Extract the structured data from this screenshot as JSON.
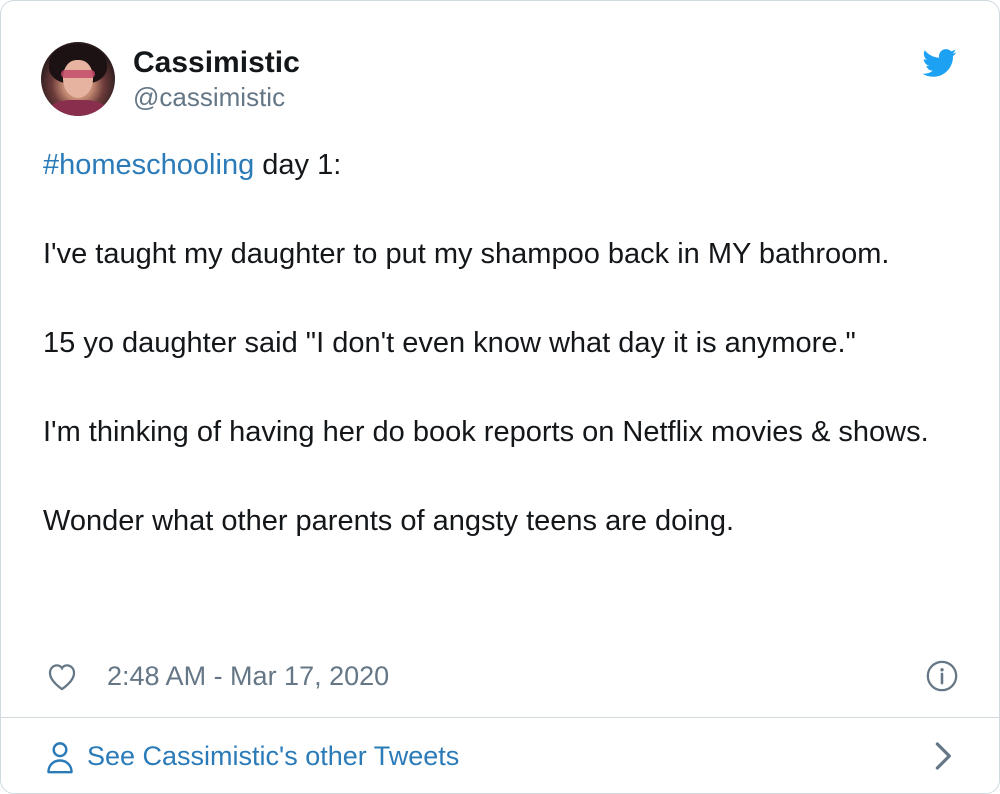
{
  "user": {
    "display_name": "Cassimistic",
    "handle": "@cassimistic"
  },
  "tweet": {
    "hashtag": "#homeschooling",
    "line1_rest": " day 1:",
    "para2": "I've taught my daughter to put my shampoo back in MY bathroom.",
    "para3": "15 yo daughter said \"I don't even know what day it is anymore.\"",
    "para4": "I'm thinking of having her do book reports on Netflix movies & shows.",
    "para5": "Wonder what other parents of angsty teens are doing."
  },
  "meta": {
    "timestamp": "2:48 AM - Mar 17, 2020"
  },
  "footer": {
    "label": "See Cassimistic's other Tweets"
  },
  "icons": {
    "brand": "twitter-bird-icon",
    "like": "heart-icon",
    "info": "info-icon",
    "profile": "person-icon",
    "more": "chevron-right-icon"
  },
  "colors": {
    "brand_blue": "#1da1f2",
    "link_blue": "#2b7bb9",
    "text": "#14171a",
    "muted": "#657786",
    "border": "#cfd9de"
  }
}
